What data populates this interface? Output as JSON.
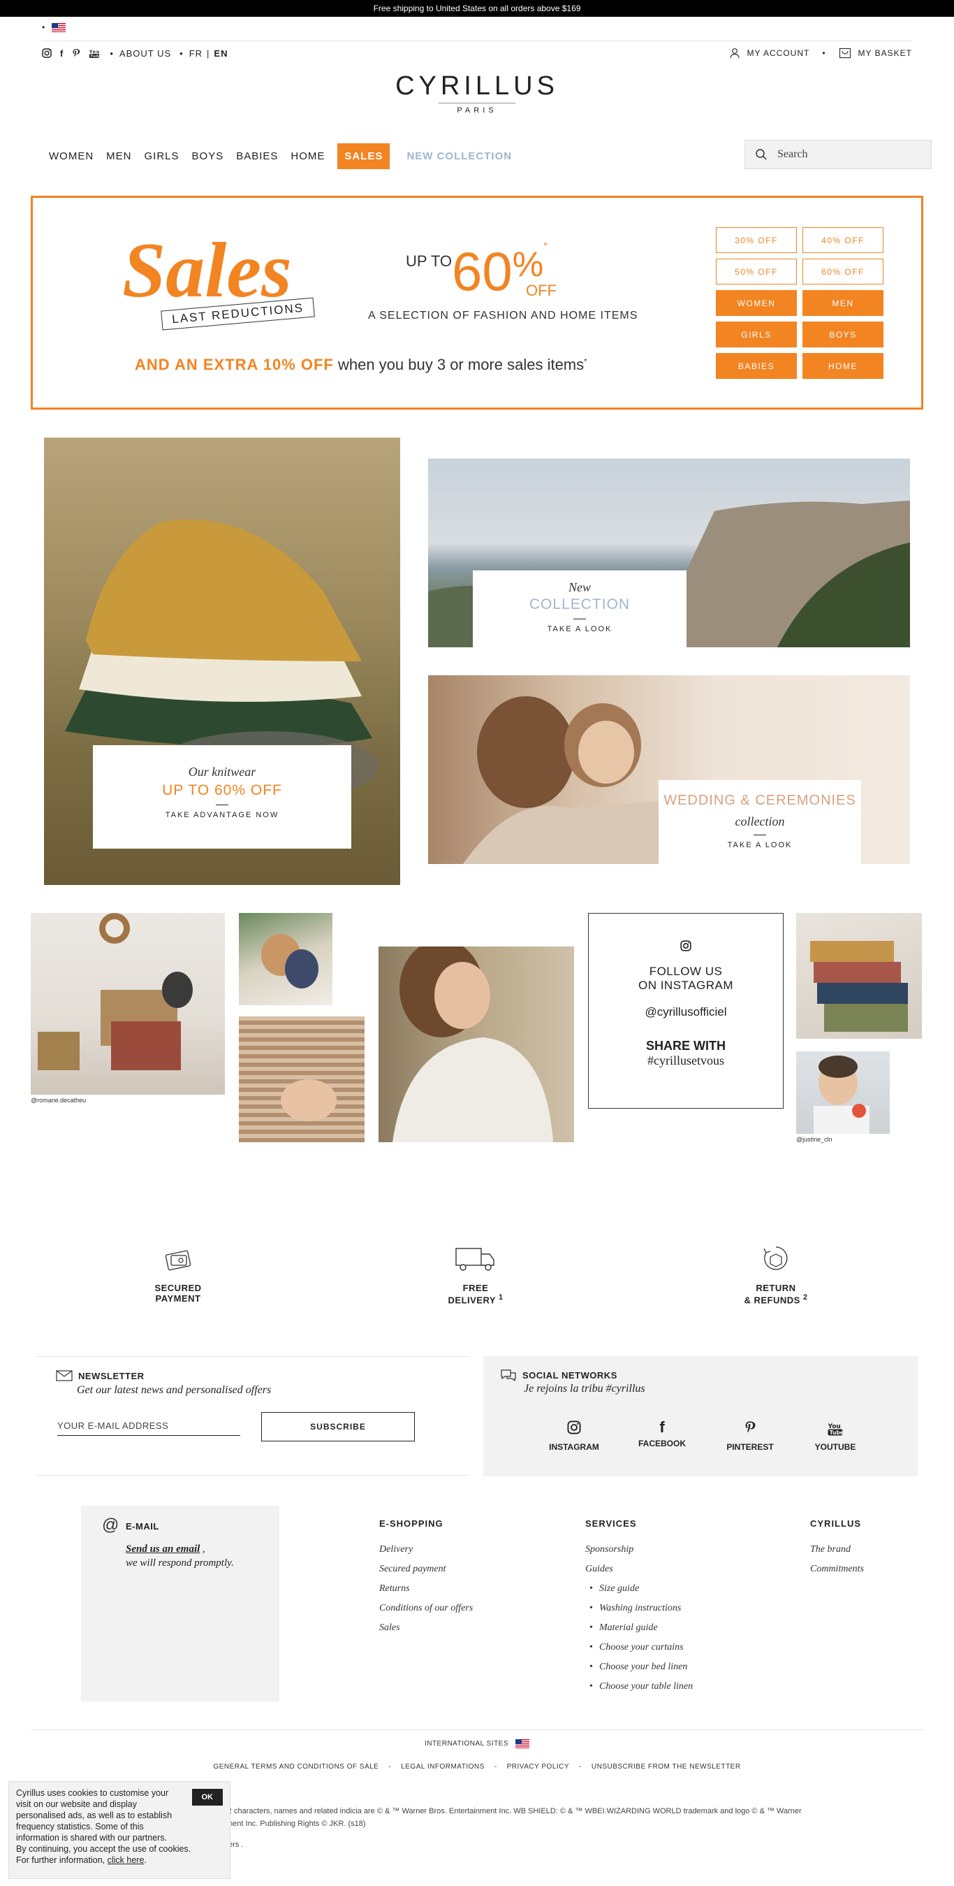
{
  "topbar": {
    "text": "Free shipping to United States on all orders above $169"
  },
  "util": {
    "about": "ABOUT US",
    "lang_fr": "FR",
    "lang_sep": "|",
    "lang_en": "EN",
    "account": "MY ACCOUNT",
    "basket": "MY BASKET"
  },
  "logo": {
    "brand": "CYRILLUS",
    "sub": "PARIS"
  },
  "nav": {
    "items": [
      "WOMEN",
      "MEN",
      "GIRLS",
      "BOYS",
      "BABIES",
      "HOME"
    ],
    "sales": "SALES",
    "new_collection": "NEW COLLECTION"
  },
  "search": {
    "placeholder": "Search"
  },
  "salesbanner": {
    "script": "Sales",
    "last": "LAST REDUCTIONS",
    "upto": "UP TO",
    "percent": "60",
    "percent_sign": "%",
    "asterisk": "*",
    "off": "OFF",
    "selection": "A SELECTION OF FASHION AND HOME ITEMS",
    "extra_bold": "AND AN EXTRA 10% OFF",
    "extra_text": "when you buy 3 or more sales items",
    "extra_star": "*",
    "buttons": [
      "30% OFF",
      "40% OFF",
      "50% OFF",
      "60% OFF",
      "WOMEN",
      "MEN",
      "GIRLS",
      "BOYS",
      "BABIES",
      "HOME"
    ]
  },
  "knit": {
    "title": "Our knitwear",
    "headline": "UP TO 60% OFF",
    "cta": "TAKE ADVANTAGE NOW"
  },
  "newcol": {
    "title": "New",
    "headline": "COLLECTION",
    "cta": "TAKE A LOOK"
  },
  "wedding": {
    "headline": "WEDDING & CEREMONIES",
    "title": "collection",
    "cta": "TAKE A LOOK"
  },
  "instagram": {
    "follow": "FOLLOW US",
    "on": "ON INSTAGRAM",
    "account": "@cyrillusofficiel",
    "share": "SHARE WITH",
    "tag": "#cyrillusetvous",
    "handle1": "@romane.decatheu",
    "handle2": "@justine_cln"
  },
  "reassurance": [
    {
      "l1": "SECURED",
      "l2": "PAYMENT",
      "sup": ""
    },
    {
      "l1": "FREE",
      "l2": "DELIVERY",
      "sup": "1"
    },
    {
      "l1": "RETURN",
      "l2": "& REFUNDS",
      "sup": "2"
    }
  ],
  "newsletter": {
    "title": "NEWSLETTER",
    "subtitle": "Get our latest news and personalised offers",
    "placeholder": "YOUR E-MAIL ADDRESS",
    "button": "SUBSCRIBE"
  },
  "socialnetworks": {
    "title": "SOCIAL NETWORKS",
    "subtitle": "Je rejoins la tribu #cyrillus",
    "items": [
      "INSTAGRAM",
      "FACEBOOK",
      "PINTEREST",
      "YOUTUBE"
    ]
  },
  "email": {
    "title": "E-MAIL",
    "link": "Send us an email",
    "after_link": " ,",
    "line2": "we will respond promptly."
  },
  "footer": {
    "eshopping": {
      "title": "E-SHOPPING",
      "items": [
        "Delivery",
        "Secured payment",
        "Returns",
        "Conditions of our offers",
        "Sales"
      ]
    },
    "services": {
      "title": "SERVICES",
      "items": [
        "Sponsorship",
        "Guides"
      ],
      "subitems": [
        "Size guide",
        "Washing instructions",
        "Material guide",
        "Choose your curtains",
        "Choose your bed linen",
        "Choose your table linen"
      ]
    },
    "cyrillus": {
      "title": "CYRILLUS",
      "items": [
        "The brand",
        "Commitments"
      ]
    }
  },
  "legal": {
    "intl": "INTERNATIONAL SITES",
    "links": [
      "GENERAL TERMS AND CONDITIONS OF SALE",
      "LEGAL INFORMATIONS",
      "PRIVACY POLICY",
      "UNSUBSCRIBE FROM THE NEWSLETTER"
    ],
    "copy1": "R characters, names and related indicia are © & ™ Warner Bros. Entertainment Inc. WB SHIELD: © & ™ WBEI.WIZARDING WORLD trademark and logo © & ™ Warner",
    "copy2": "ment Inc. Publishing Rights © JKR. (s18)",
    "copy3": "fers ."
  },
  "cookie": {
    "text": "Cyrillus uses cookies to customise your visit on our website and display personalised ads, as well as to establish frequency statistics. Some of this information is shared with our partners.",
    "text2": "By continuing, you accept the use of cookies.",
    "text3": "For further information,",
    "link": "click here",
    "ok": "OK"
  },
  "colors": {
    "orange": "#f28422",
    "lightblue": "#9eb6cf",
    "wedding": "#d7a07e"
  }
}
